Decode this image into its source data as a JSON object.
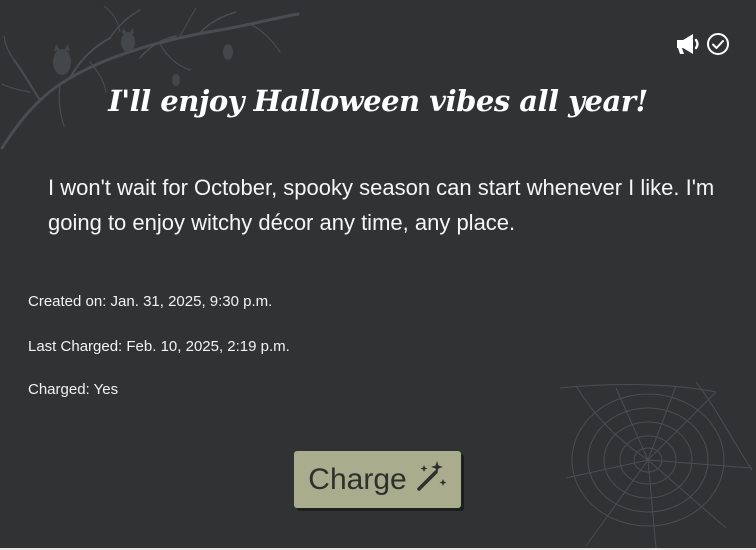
{
  "goal": {
    "title": "I'll enjoy Halloween vibes all year!",
    "description": "I won't wait for October, spooky season can start whenever I like. I'm going to enjoy witchy décor any time, any place."
  },
  "meta": {
    "created": "Created on: Jan. 31, 2025, 9:30 p.m.",
    "last_charged": "Last Charged: Feb. 10, 2025, 2:19 p.m.",
    "charged": "Charged: Yes"
  },
  "actions": {
    "charge_label": "Charge",
    "announce_icon": "megaphone-icon",
    "done_icon": "check-circle-icon"
  },
  "colors": {
    "background": "#303234",
    "button": "#a9ad8e",
    "text": "#ffffff"
  }
}
